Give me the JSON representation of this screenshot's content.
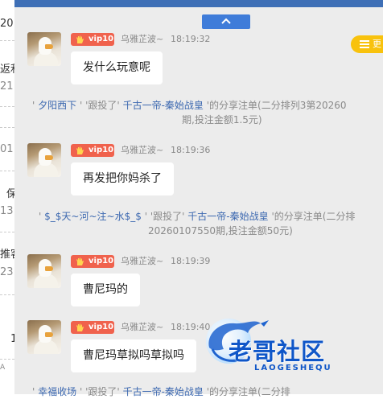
{
  "background_page": {
    "fragments": [
      "20",
      "返利",
      "21",
      "01",
      "保",
      "13",
      "推客",
      "23",
      "1",
      "A"
    ]
  },
  "more_button": {
    "label": "更"
  },
  "messages": [
    {
      "vip_label": "vip10",
      "username": "乌雅芷波~",
      "time": "18:19:32",
      "text": "发什么玩意呢"
    },
    {
      "vip_label": "vip10",
      "username": "乌雅芷波~",
      "time": "18:19:36",
      "text": "再发把你妈杀了"
    },
    {
      "vip_label": "vip10",
      "username": "乌雅芷波~",
      "time": "18:19:39",
      "text": "曹尼玛的"
    },
    {
      "vip_label": "vip10",
      "username": "乌雅芷波~",
      "time": "18:19:40",
      "text": "曹尼玛草拟吗草拟吗"
    }
  ],
  "notices": [
    {
      "q1": "'",
      "user": "夕阳西下",
      "q2": "'",
      "follow": "'跟投了'",
      "plan": "千古一帝-秦始战皇",
      "tail1": "'的分享注单(二分排列3第20260",
      "tail2": "期,投注金额1.5元)"
    },
    {
      "q1": "'",
      "user": "$_$天~河~注~水$_$",
      "q2": "'",
      "follow": "'跟投了'",
      "plan": "千古一帝-秦始战皇",
      "tail1": "'的分享注单(二分排",
      "tail2": "20260107550期,投注金额50元)"
    },
    {
      "q1": "'",
      "user": "幸福收场",
      "q2": "'",
      "follow": "'跟投了'",
      "plan": "千古一帝-秦始战皇",
      "tail1": "'的分享注单(二分排"
    }
  ],
  "watermark": {
    "title": "老哥社区",
    "subtitle": "LAOGESHEQU"
  },
  "colors": {
    "chat_bg": "#ececec",
    "link": "#3c68b0",
    "vip": "#f0624d",
    "accent": "#3f7cd9",
    "more": "#f8c20d"
  }
}
